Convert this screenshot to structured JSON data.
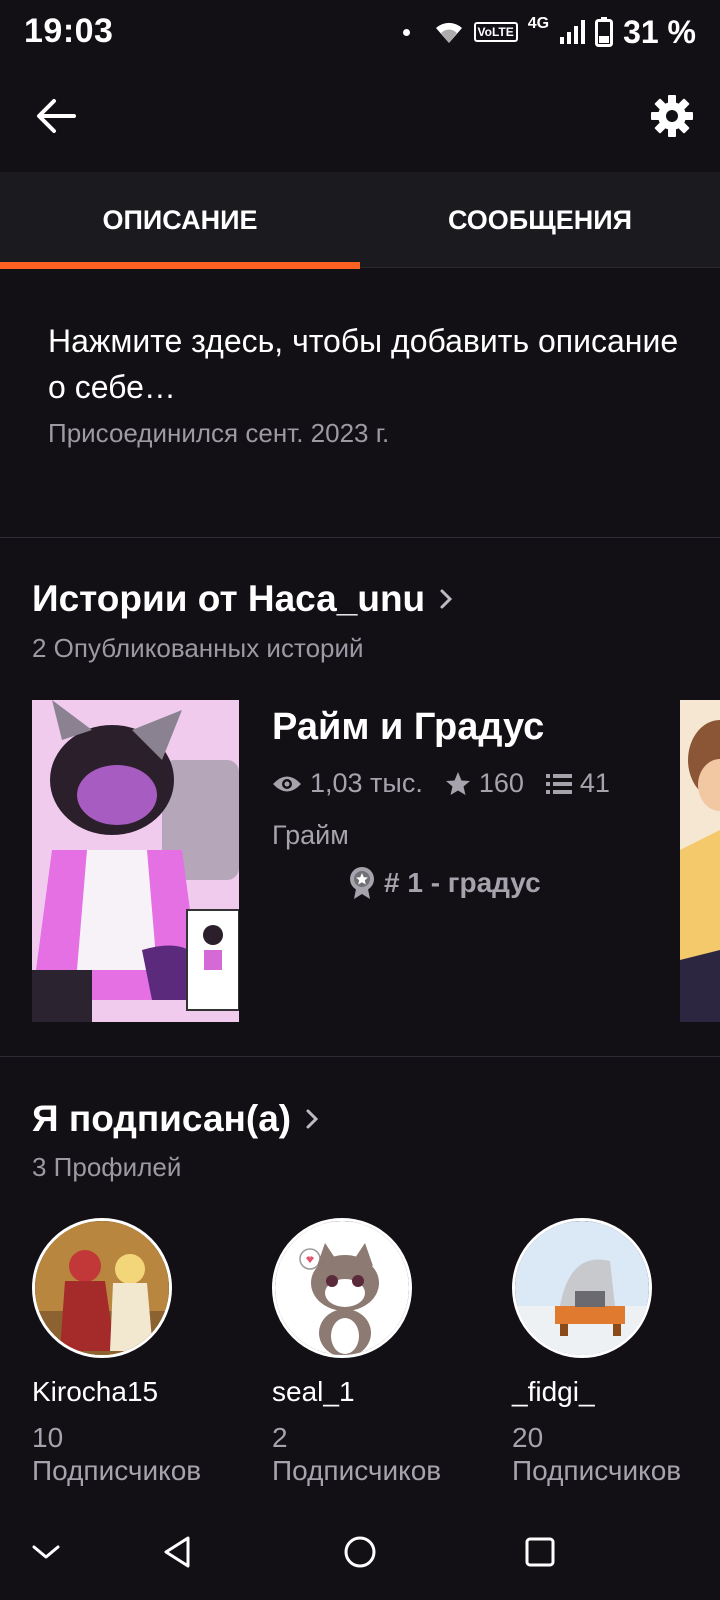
{
  "status_bar": {
    "time": "19:03",
    "volte": "VoLTE",
    "network": "4G",
    "battery": "31 %",
    "icons": [
      "notification-dot",
      "wifi-icon",
      "volte-icon",
      "signal-icon",
      "battery-icon"
    ]
  },
  "app_bar": {
    "icons": [
      "back-arrow-icon",
      "gear-icon"
    ]
  },
  "tabs": [
    {
      "label": "ОПИСАНИЕ",
      "selected": true
    },
    {
      "label": "СООБЩЕНИЯ",
      "selected": false
    }
  ],
  "accent_color": "#ff6122",
  "description": {
    "text": "Нажмите здесь, чтобы добавить описание о себе…",
    "joined": "Присоединился сент. 2023 г."
  },
  "stories_section": {
    "title": "Истории от Наса_unu",
    "subtitle": "2 Опубликованных историй",
    "story": {
      "title": "Райм и Градус",
      "views": "1,03 тыс.",
      "votes": "160",
      "parts": "41",
      "tag": "Грайм",
      "rank": "# 1 - градус",
      "icons": [
        "eye-icon",
        "star-icon",
        "list-icon",
        "rank-badge-icon"
      ]
    }
  },
  "following_section": {
    "title": "Я подписан(а)",
    "subtitle": "3 Профилей",
    "profiles": [
      {
        "name": "Kirocha15",
        "count": "10",
        "label": "Подписчиков"
      },
      {
        "name": "seal_1",
        "count": "2",
        "label": "Подписчиков"
      },
      {
        "name": "_fidgi_",
        "count": "20",
        "label": "Подписчиков"
      }
    ]
  },
  "nav_bar": {
    "icons": [
      "collapse-chevron-icon",
      "back-triangle-icon",
      "home-circle-icon",
      "recents-square-icon"
    ]
  }
}
